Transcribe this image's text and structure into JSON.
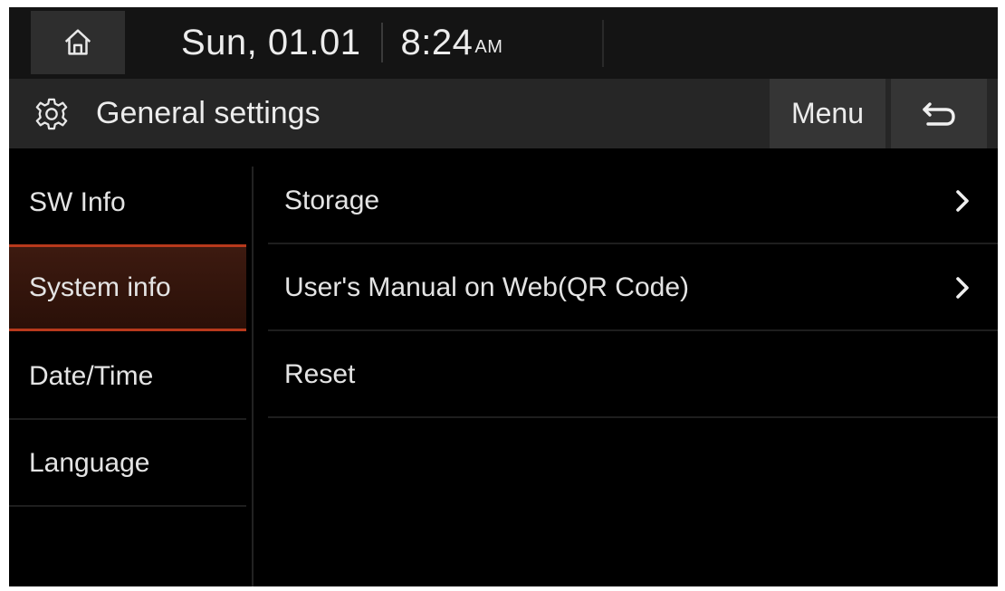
{
  "status_bar": {
    "home_icon": "home-icon",
    "date": "Sun, 01.01",
    "time": "8:24",
    "ampm": "AM"
  },
  "title_bar": {
    "icon": "gear-icon",
    "title": "General settings",
    "menu_label": "Menu",
    "back_icon": "back-arrow-icon"
  },
  "sidebar": {
    "items": [
      {
        "label": "SW Info",
        "active": false
      },
      {
        "label": "System info",
        "active": true
      },
      {
        "label": "Date/Time",
        "active": false
      },
      {
        "label": "Language",
        "active": false
      }
    ]
  },
  "content": {
    "items": [
      {
        "label": "Storage",
        "has_chevron": true
      },
      {
        "label": "User's Manual on Web(QR Code)",
        "has_chevron": true
      },
      {
        "label": "Reset",
        "has_chevron": false
      }
    ]
  },
  "colors": {
    "accent": "#b8391c",
    "background": "#000000",
    "bar": "#262626"
  }
}
